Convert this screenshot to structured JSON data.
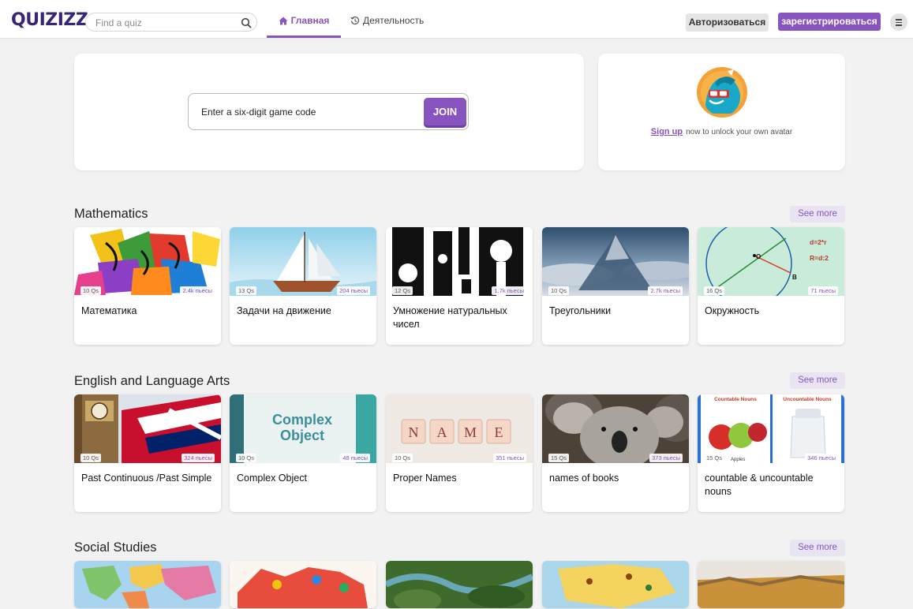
{
  "header": {
    "logo": "QUIZIZZ",
    "search_placeholder": "Find a quiz",
    "tab_home": "Главная",
    "tab_activity": "Деятельность",
    "login_label": "Авторизоваться",
    "signup_label": "зарегистрироваться"
  },
  "join": {
    "placeholder": "Enter a six-digit game code",
    "button": "JOIN"
  },
  "avatar_card": {
    "signup_link": "Sign up",
    "text": "now to unlock your own avatar"
  },
  "colors": {
    "accent": "#8854c0",
    "brand": "#3a2474"
  },
  "sections": [
    {
      "title": "Mathematics",
      "see_more": "See more",
      "cards": [
        {
          "qs": "10 Qs",
          "plays": "2.4k пьесы",
          "title": "Математика"
        },
        {
          "qs": "13 Qs",
          "plays": "204 пьесы",
          "title": "Задачи на движение"
        },
        {
          "qs": "12 Qs",
          "plays": "1.7k пьесы",
          "title": "Умножение натуральных чисел"
        },
        {
          "qs": "10 Qs",
          "plays": "2.7k пьесы",
          "title": "Треугольники"
        },
        {
          "qs": "16 Qs",
          "plays": "71 пьесы",
          "title": "Окружность",
          "thumb_text": [
            "d=2*r",
            "R=d:2",
            "O",
            "B"
          ]
        }
      ]
    },
    {
      "title": "English and Language Arts",
      "see_more": "See more",
      "cards": [
        {
          "qs": "10 Qs",
          "plays": "324 пьесы",
          "title": "Past Continuous /Past Simple"
        },
        {
          "qs": "10 Qs",
          "plays": "48 пьесы",
          "title": "Complex Object",
          "thumb_text": [
            "Complex",
            "Object"
          ]
        },
        {
          "qs": "10 Qs",
          "plays": "351 пьесы",
          "title": "Proper Names",
          "thumb_text": [
            "N",
            "A",
            "M",
            "E"
          ]
        },
        {
          "qs": "15 Qs",
          "plays": "373 пьесы",
          "title": "names of books"
        },
        {
          "qs": "15 Qs",
          "plays": "346 пьесы",
          "title": "countable & uncountable nouns",
          "thumb_text": [
            "Countable Nouns",
            "Uncountable Nouns",
            "Apples"
          ]
        }
      ]
    },
    {
      "title": "Social Studies",
      "see_more": "See more",
      "cards": [
        {},
        {},
        {},
        {},
        {}
      ]
    }
  ]
}
